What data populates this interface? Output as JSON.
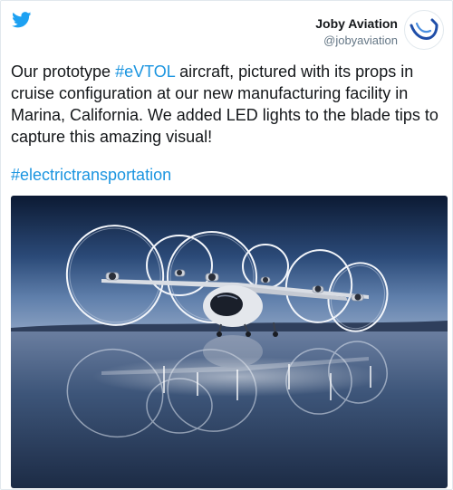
{
  "author": {
    "name": "Joby Aviation",
    "handle": "@jobyaviation"
  },
  "tweet": {
    "text_before": "Our prototype ",
    "hashtag_inline": "#eVTOL",
    "text_after": " aircraft, pictured with its props in cruise configuration at our new manufacturing facility in Marina, California. We added LED lights to the blade tips to capture this amazing visual!",
    "hashtag_footer": "#electrictransportation"
  },
  "icons": {
    "platform": "twitter-bird-icon",
    "avatar": "joby-logo-icon"
  },
  "colors": {
    "link": "#1b95e0",
    "twitter_blue": "#1da1f2",
    "logo_blue": "#1f4ea8"
  }
}
